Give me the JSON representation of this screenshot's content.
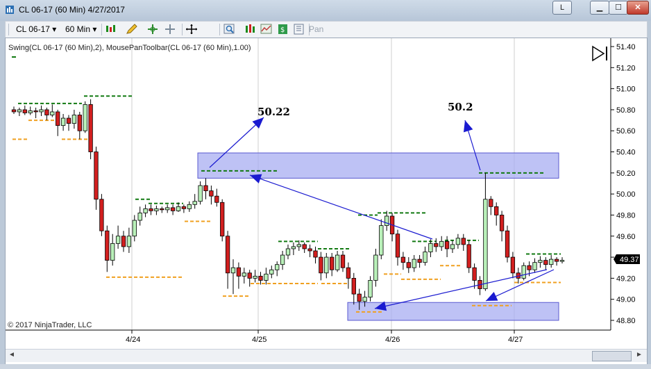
{
  "window": {
    "title": "CL 06-17 (60 Min)  4/27/2017",
    "minimize_icon": "minimize-icon",
    "maximize_icon": "maximize-icon",
    "close_icon": "close-icon",
    "layout_button_label": "L"
  },
  "toolbar": {
    "instrument": "CL 06-17",
    "period": "60 Min",
    "pan_label": "Pan"
  },
  "chart": {
    "indicator_label": "Swing(CL 06-17 (60 Min),2), MousePanToolbar(CL 06-17 (60 Min),1.00)",
    "copyright": "© 2017 NinjaTrader, LLC",
    "last_price": "49.37",
    "annotation_left": "50.22",
    "annotation_right": "50.2",
    "y_ticks": [
      "51.40",
      "51.20",
      "51.00",
      "50.80",
      "50.60",
      "50.40",
      "50.20",
      "50.00",
      "49.80",
      "49.60",
      "49.40",
      "49.20",
      "49.00",
      "48.80"
    ],
    "x_labels": [
      "4/24",
      "4/25",
      "4/26",
      "4/27"
    ]
  },
  "chart_data": {
    "type": "candlestick",
    "ylim": [
      48.72,
      51.42
    ],
    "x": [
      "4/24",
      "4/25",
      "4/26",
      "4/27"
    ],
    "colors": {
      "up": "#b9f0b9",
      "down": "#d21f1f",
      "swing_high": "#127a12",
      "swing_low": "#f0a020",
      "zone": "#a8aef2",
      "arrow": "#1a1ad0"
    },
    "annotations": [
      50.22,
      50.2
    ],
    "last_price": 49.37
  }
}
